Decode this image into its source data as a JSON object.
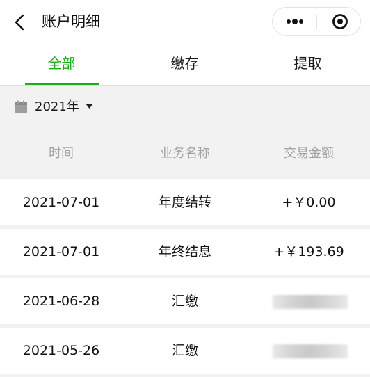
{
  "nav": {
    "title": "账户明细",
    "back_icon": "chevron-left-icon",
    "more_icon": "more-dots-icon",
    "close_icon": "target-close-icon"
  },
  "tabs": [
    {
      "label": "全部",
      "active": true
    },
    {
      "label": "缴存",
      "active": false
    },
    {
      "label": "提取",
      "active": false
    }
  ],
  "filter": {
    "year_label": "2021年",
    "calendar_icon": "calendar-icon",
    "dropdown_icon": "caret-down-icon"
  },
  "table": {
    "headers": [
      "时间",
      "业务名称",
      "交易金额"
    ],
    "rows": [
      {
        "date": "2021-07-01",
        "business": "年度结转",
        "amount": "+￥0.00"
      },
      {
        "date": "2021-07-01",
        "business": "年终结息",
        "amount": "+￥193.69"
      },
      {
        "date": "2021-06-28",
        "business": "汇缴",
        "amount": ""
      },
      {
        "date": "2021-05-26",
        "business": "汇缴",
        "amount": ""
      }
    ]
  },
  "colors": {
    "accent": "#1aad19",
    "background": "#f2f2f2",
    "header_text": "#a3a3a3"
  }
}
